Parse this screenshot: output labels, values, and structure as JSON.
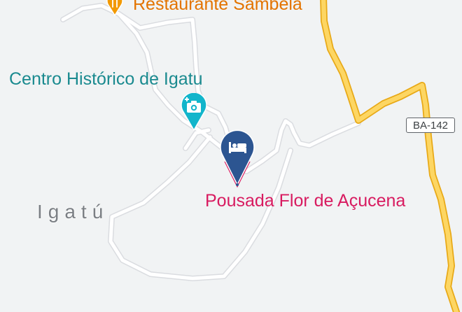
{
  "map": {
    "colors": {
      "background": "#f1f3f4",
      "local_road": "#ffffff",
      "local_road_casing": "#dadce0",
      "highway": "#fdd663",
      "highway_casing": "#e8a917",
      "hotel_pin": "#2c5591",
      "selected_marker": "#ec6f8f"
    },
    "labels": {
      "restaurant": "Restaurante Sambelá",
      "historic_center": "Centro Histórico de Igatu",
      "place": "Igatú",
      "lodging": "Pousada Flor de Açucena"
    },
    "road_shield": {
      "text": "BA-142"
    },
    "icons": {
      "restaurant": "fork-knife-icon",
      "historic_center": "camera-icon",
      "lodging": "bed-icon"
    }
  }
}
